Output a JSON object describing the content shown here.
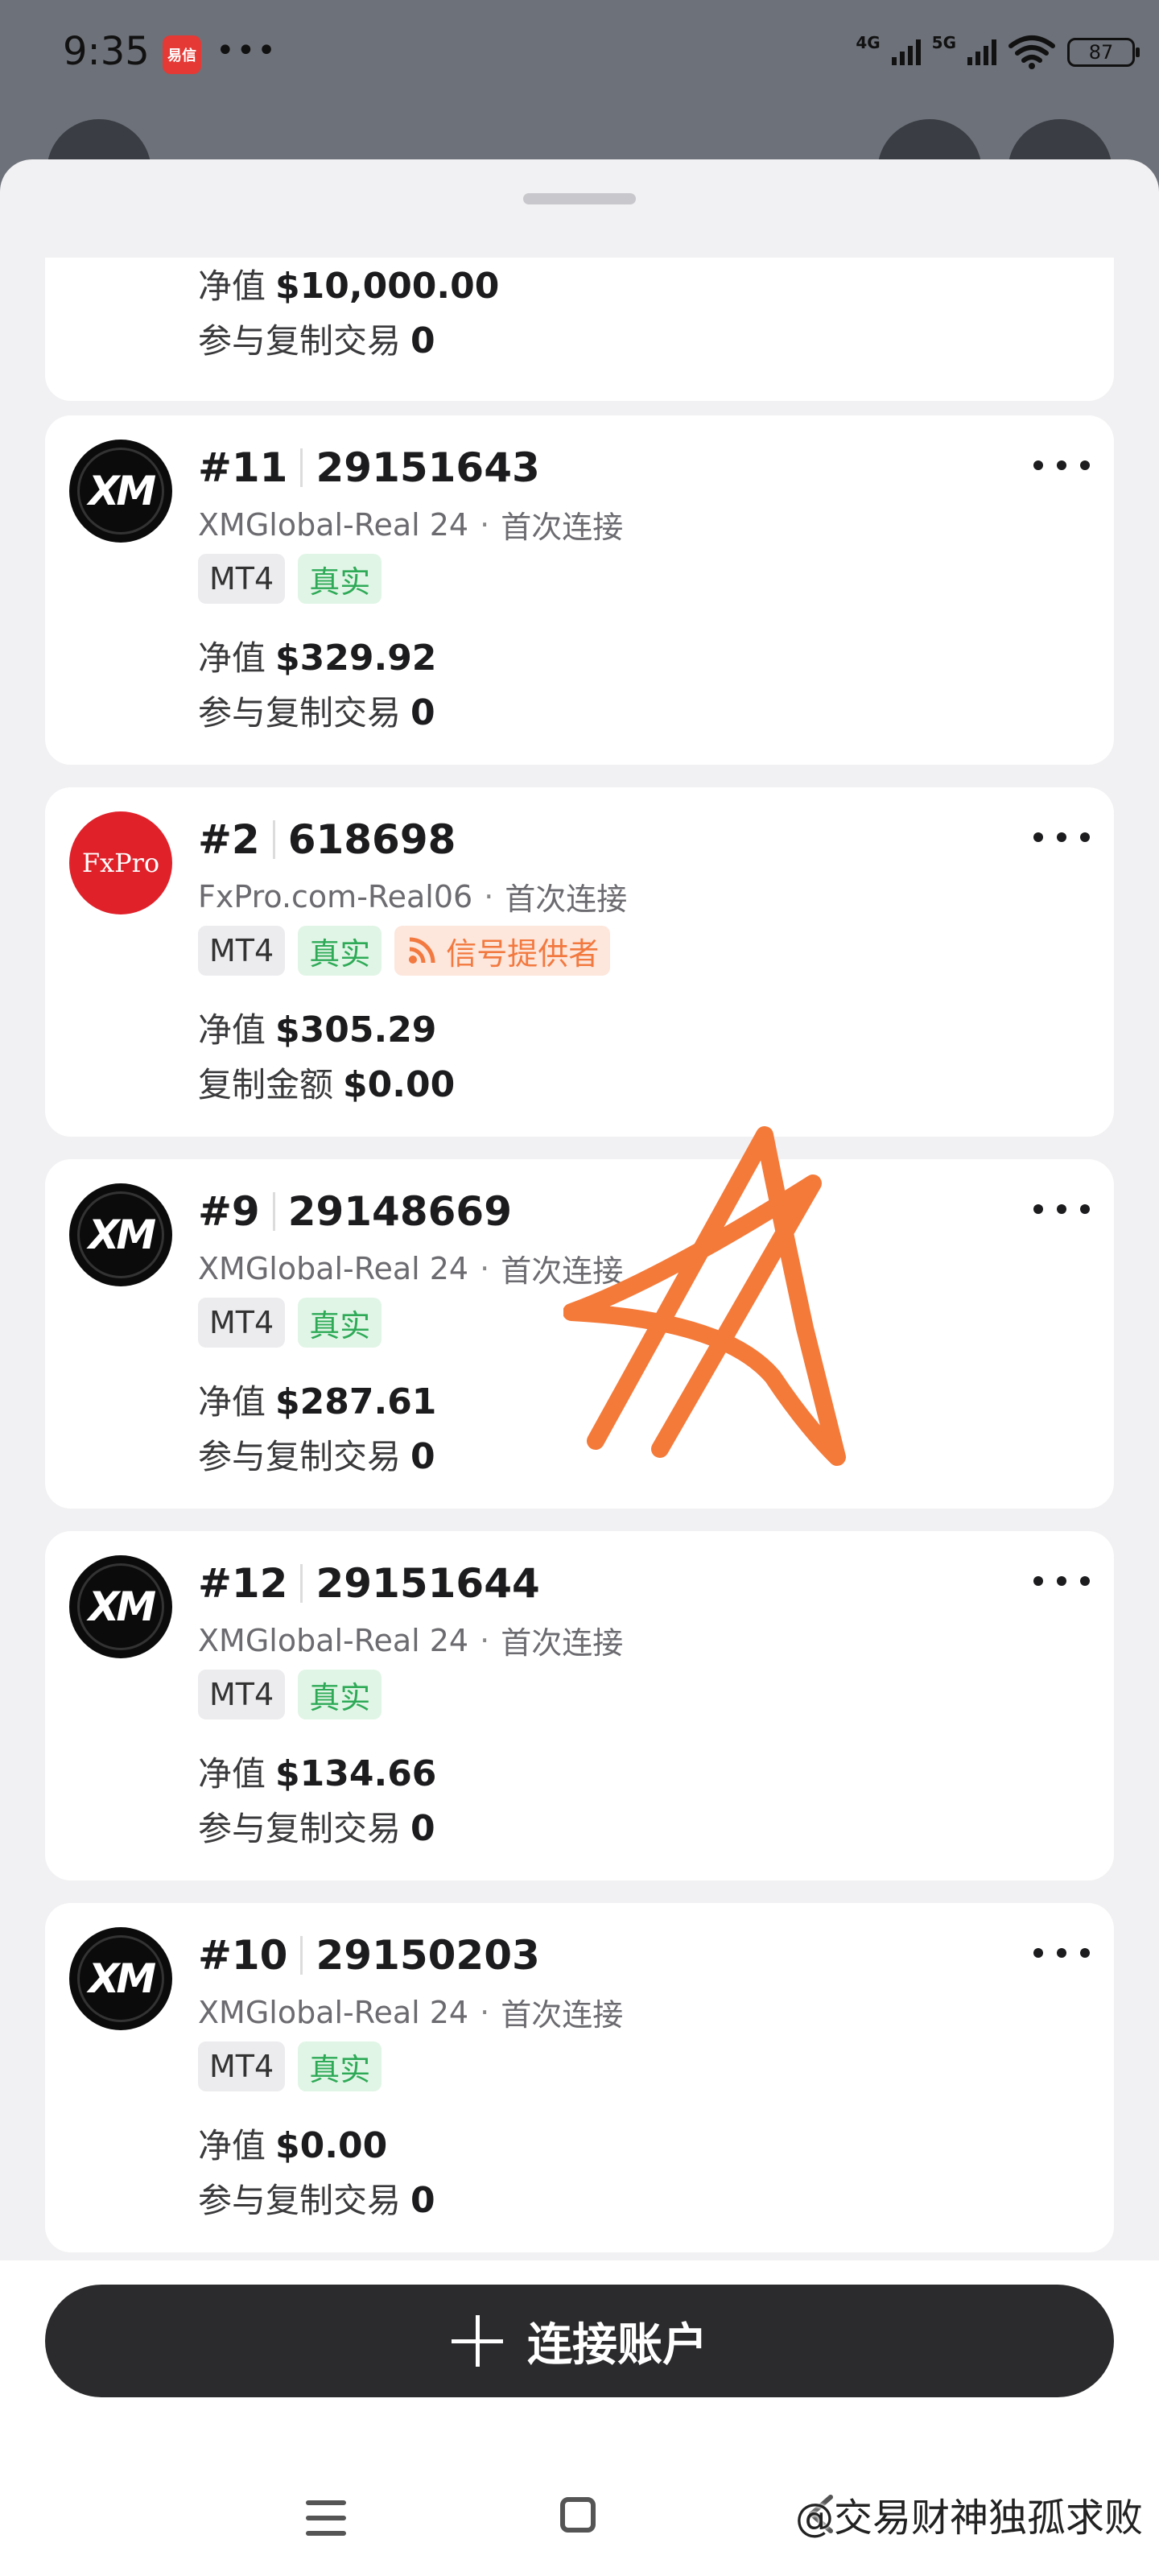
{
  "status_bar": {
    "time": "9:35",
    "app_icon_text": "易信",
    "dots": "•••",
    "net1": "4G",
    "net2": "5G",
    "battery": "87"
  },
  "partial_card": {
    "equity_label": "净值",
    "equity_value": "$10,000.00",
    "stat_label": "参与复制交易",
    "stat_value": "0"
  },
  "cards": [
    {
      "logo": "XM",
      "num": "#11",
      "id": "29151643",
      "server": "XMGlobal-Real 24",
      "conn": "首次连接",
      "tag_platform": "MT4",
      "tag_type": "真实",
      "equity_label": "净值",
      "equity_value": "$329.92",
      "stat_label": "参与复制交易",
      "stat_value": "0"
    },
    {
      "logo": "FxPro",
      "num": "#2",
      "id": "618698",
      "server": "FxPro.com-Real06",
      "conn": "首次连接",
      "tag_platform": "MT4",
      "tag_type": "真实",
      "tag_signal": "信号提供者",
      "equity_label": "净值",
      "equity_value": "$305.29",
      "stat_label": "复制金额",
      "stat_value": "$0.00"
    },
    {
      "logo": "XM",
      "num": "#9",
      "id": "29148669",
      "server": "XMGlobal-Real 24",
      "conn": "首次连接",
      "tag_platform": "MT4",
      "tag_type": "真实",
      "equity_label": "净值",
      "equity_value": "$287.61",
      "stat_label": "参与复制交易",
      "stat_value": "0"
    },
    {
      "logo": "XM",
      "num": "#12",
      "id": "29151644",
      "server": "XMGlobal-Real 24",
      "conn": "首次连接",
      "tag_platform": "MT4",
      "tag_type": "真实",
      "equity_label": "净值",
      "equity_value": "$134.66",
      "stat_label": "参与复制交易",
      "stat_value": "0"
    },
    {
      "logo": "XM",
      "num": "#10",
      "id": "29150203",
      "server": "XMGlobal-Real 24",
      "conn": "首次连接",
      "tag_platform": "MT4",
      "tag_type": "真实",
      "equity_label": "净值",
      "equity_value": "$0.00",
      "stat_label": "参与复制交易",
      "stat_value": "0"
    }
  ],
  "connect_button": {
    "label": "连接账户"
  },
  "watermark": "@交易财神独孤求败",
  "colors": {
    "accent_green": "#2eaa57",
    "signal_orange": "#f2793f",
    "button_dark": "#2b2b2d",
    "annotation_orange": "#f47a3a"
  }
}
